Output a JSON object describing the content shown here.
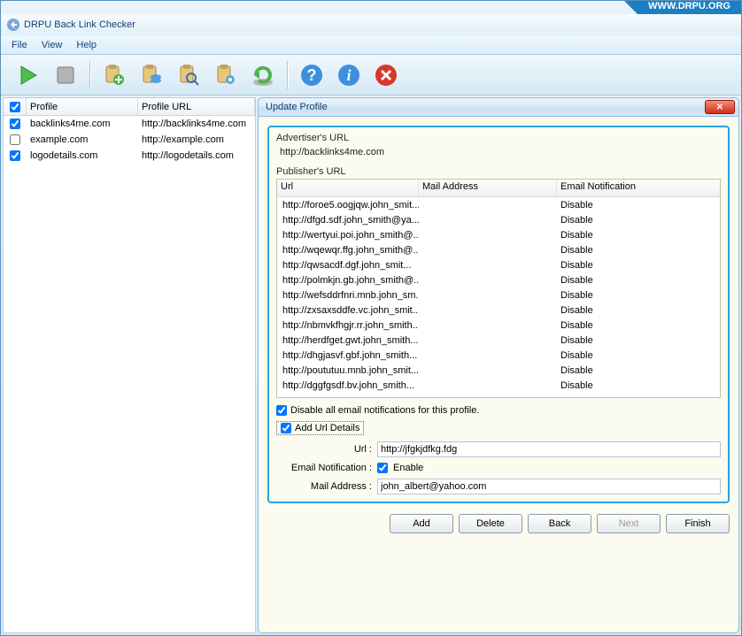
{
  "brand": "WWW.DRPU.ORG",
  "title": "DRPU Back Link Checker",
  "menu": {
    "file": "File",
    "view": "View",
    "help": "Help"
  },
  "toolbar": {
    "icons": [
      "play",
      "stop",
      "clipboard-add",
      "clipboard-db",
      "clipboard-search",
      "clipboard-gear",
      "refresh",
      "help-q",
      "info",
      "close-circle"
    ]
  },
  "left": {
    "cols": {
      "profile": "Profile",
      "profile_url": "Profile URL"
    },
    "rows": [
      {
        "checked": true,
        "profile": "backlinks4me.com",
        "url": "http://backlinks4me.com"
      },
      {
        "checked": false,
        "profile": "example.com",
        "url": "http://example.com"
      },
      {
        "checked": true,
        "profile": "logodetails.com",
        "url": "http://logodetails.com"
      }
    ]
  },
  "dialog": {
    "title": "Update Profile",
    "advertiser_label": "Advertiser's URL",
    "advertiser_url": "http://backlinks4me.com",
    "publisher_label": "Publisher's URL",
    "columns": {
      "url": "Url",
      "mail": "Mail Address",
      "email_notif": "Email Notification"
    },
    "rows": [
      {
        "url": "http://foroe5.oogjqw.john_smit...",
        "mail": "",
        "email": "Disable"
      },
      {
        "url": "http://dfgd.sdf.john_smith@ya...",
        "mail": "",
        "email": "Disable"
      },
      {
        "url": "http://wertyui.poi.john_smith@...",
        "mail": "",
        "email": "Disable"
      },
      {
        "url": "http://wqewqr.ffg.john_smith@...",
        "mail": "",
        "email": "Disable"
      },
      {
        "url": "http://qwsacdf.dgf.john_smit...",
        "mail": "",
        "email": "Disable"
      },
      {
        "url": "http://polmkjn.gb.john_smith@...",
        "mail": "",
        "email": "Disable"
      },
      {
        "url": "http://wefsddrfnri.mnb.john_sm...",
        "mail": "",
        "email": "Disable"
      },
      {
        "url": "http://zxsaxsddfe.vc.john_smit...",
        "mail": "",
        "email": "Disable"
      },
      {
        "url": "http://nbmvkfhgjr.rr.john_smith...",
        "mail": "",
        "email": "Disable"
      },
      {
        "url": "http://herdfget.gwt.john_smith...",
        "mail": "",
        "email": "Disable"
      },
      {
        "url": "http://dhgjasvf.gbf.john_smith...",
        "mail": "",
        "email": "Disable"
      },
      {
        "url": "http://poututuu.mnb.john_smit...",
        "mail": "",
        "email": "Disable"
      },
      {
        "url": "http://dggfgsdf.bv.john_smith...",
        "mail": "",
        "email": "Disable"
      }
    ],
    "disable_all_checked": true,
    "disable_all_label": "Disable all email notifications for this profile.",
    "add_group_checked": true,
    "add_group_label": "Add Url Details",
    "url_label": "Url :",
    "url_value": "http://jfgkjdfkg.fdg",
    "email_notif_label": "Email Notification :",
    "enable_checked": true,
    "enable_label": "Enable",
    "mail_addr_label": "Mail Address :",
    "mail_addr_value": "john_albert@yahoo.com",
    "buttons": {
      "add": "Add",
      "delete": "Delete",
      "back": "Back",
      "next": "Next",
      "finish": "Finish"
    }
  }
}
